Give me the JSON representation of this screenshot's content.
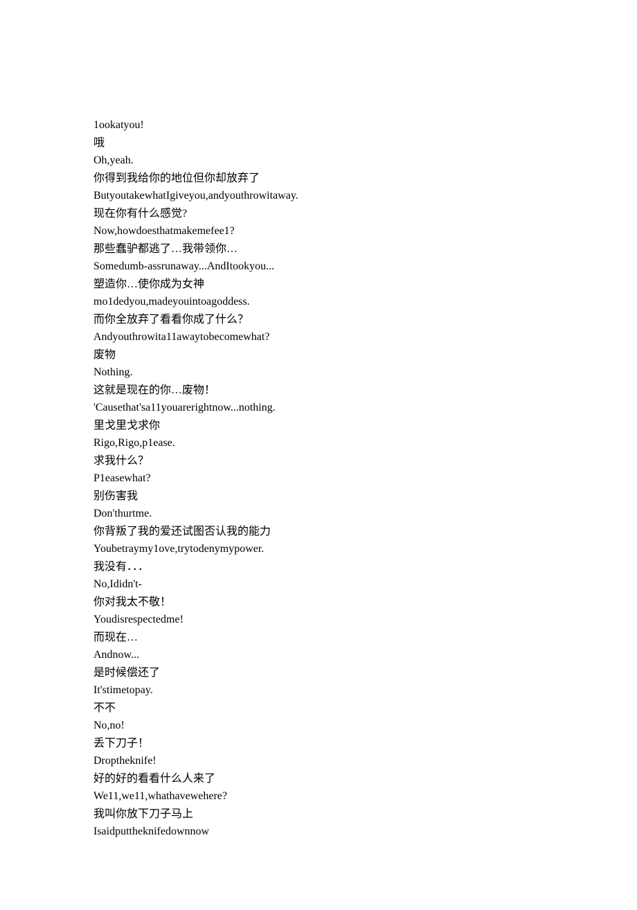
{
  "lines": [
    "1ookatyou!",
    "哦",
    "Oh,yeah.",
    "你得到我给你的地位但你却放弃了",
    "ButyoutakewhatIgiveyou,andyouthrowitaway.",
    "现在你有什么感觉?",
    "Now,howdoesthatmakemefee1?",
    "那些蠢驴都逃了…我带领你…",
    "Somedumb-assrunaway...AndItookyou...",
    "塑造你…使你成为女神",
    "mo1dedyou,madeyouintoagoddess.",
    "而你全放弃了看看你成了什么？",
    "Andyouthrowita11awaytobecomewhat?",
    "废物",
    "Nothing.",
    "这就是现在的你…废物！",
    "'Causethat'sa11youarerightnow...nothing.",
    "里戈里戈求你",
    "Rigo,Rigo,p1ease.",
    "求我什么？",
    "P1easewhat?",
    "别伤害我",
    "Don'thurtme.",
    "你背叛了我的爱还试图否认我的能力",
    "Youbetraymy1ove,trytodenymypower.",
    "我没有．．．",
    "No,Ididn't-",
    "你对我太不敬！",
    "Youdisrespectedme!",
    "而现在…",
    "Andnow...",
    "是时候偿还了",
    "It'stimetopay.",
    "不不",
    "No,no!",
    "丢下刀子！",
    "Droptheknife!",
    "好的好的看看什么人来了",
    "We11,we11,whathavewehere?",
    "我叫你放下刀子马上",
    "Isaidputtheknifedownnow"
  ]
}
